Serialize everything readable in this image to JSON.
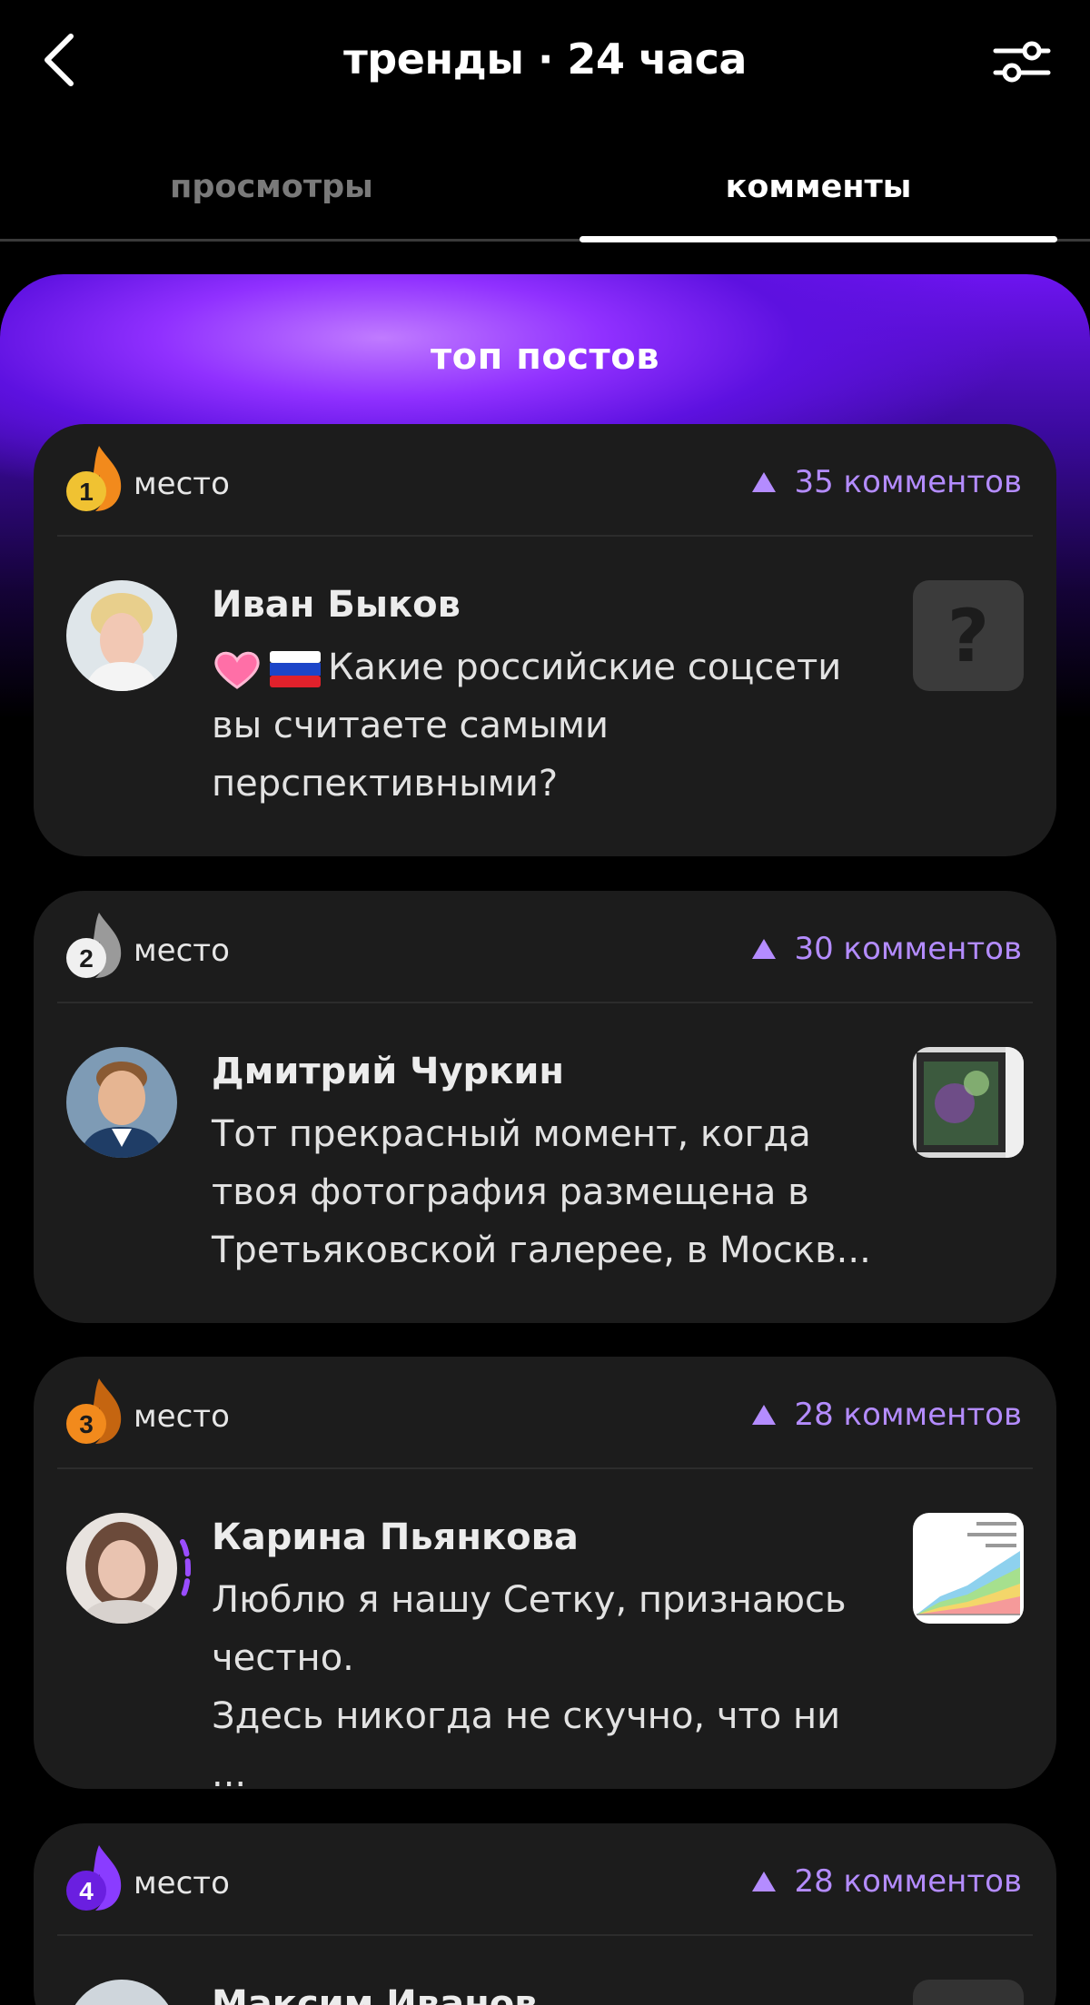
{
  "header": {
    "title": "тренды · 24 часа",
    "back_icon": "chevron-left-icon",
    "filter_icon": "sliders-icon"
  },
  "tabs": [
    {
      "label": "просмотры",
      "active": false
    },
    {
      "label": "комменты",
      "active": true
    }
  ],
  "hero": {
    "title": "топ постов"
  },
  "colors": {
    "accent": "#b48cff",
    "card_bg": "#1c1c1c",
    "hero_purple": "#7a1dff",
    "rank1": "#f0c232",
    "rank2": "#f0f0f0",
    "rank3": "#f28a1c",
    "rank4": "#8a3cff"
  },
  "posts": [
    {
      "rank": "1",
      "rank_label": "место",
      "comments": "35 комментов",
      "author": "Иван Быков",
      "text": "Какие российские соцсети вы считаете самыми перспективными?",
      "thumb": "question-icon",
      "thumb_text": "?"
    },
    {
      "rank": "2",
      "rank_label": "место",
      "comments": "30 комментов",
      "author": "Дмитрий Чуркин",
      "text": "Тот прекрасный момент, когда твоя фотография размещена в Третьяковской галерее, в Москв...",
      "thumb": "photo-frame"
    },
    {
      "rank": "3",
      "rank_label": "место",
      "comments": "28 комментов",
      "author": "Карина Пьянкова",
      "text_lines": [
        "Люблю я нашу Сетку, признаюсь",
        "честно.",
        "Здесь никогда не скучно, что ни ..."
      ],
      "thumb": "chart-image"
    },
    {
      "rank": "4",
      "rank_label": "место",
      "comments": "28 комментов",
      "author": "Максим Иванов"
    }
  ]
}
